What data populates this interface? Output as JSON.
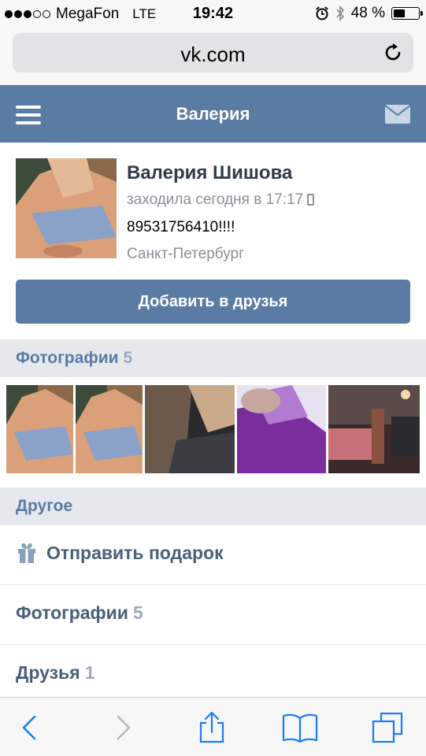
{
  "status_bar": {
    "carrier": "MegaFon",
    "network": "LTE",
    "time": "19:42",
    "battery": "48 %",
    "battery_level": 0.48,
    "signal_bars": 3
  },
  "browser": {
    "url": "vk.com"
  },
  "header": {
    "title": "Валерия"
  },
  "profile": {
    "name": "Валерия Шишова",
    "last_seen": "заходила сегодня в 17:17",
    "phone_text": "89531756410!!!!",
    "city": "Санкт-Петербург",
    "add_friend_label": "Добавить в друзья"
  },
  "photos_section": {
    "label": "Фотографии",
    "count": "5"
  },
  "other_section": {
    "label": "Другое"
  },
  "menu": {
    "gift_label": "Отправить подарок",
    "photos_label": "Фотографии",
    "photos_count": "5",
    "friends_label": "Друзья",
    "friends_count": "1"
  },
  "colors": {
    "vk_blue": "#5a7ba3",
    "section_bg": "#e5e9ee",
    "ios_blue": "#1a7cf5"
  }
}
